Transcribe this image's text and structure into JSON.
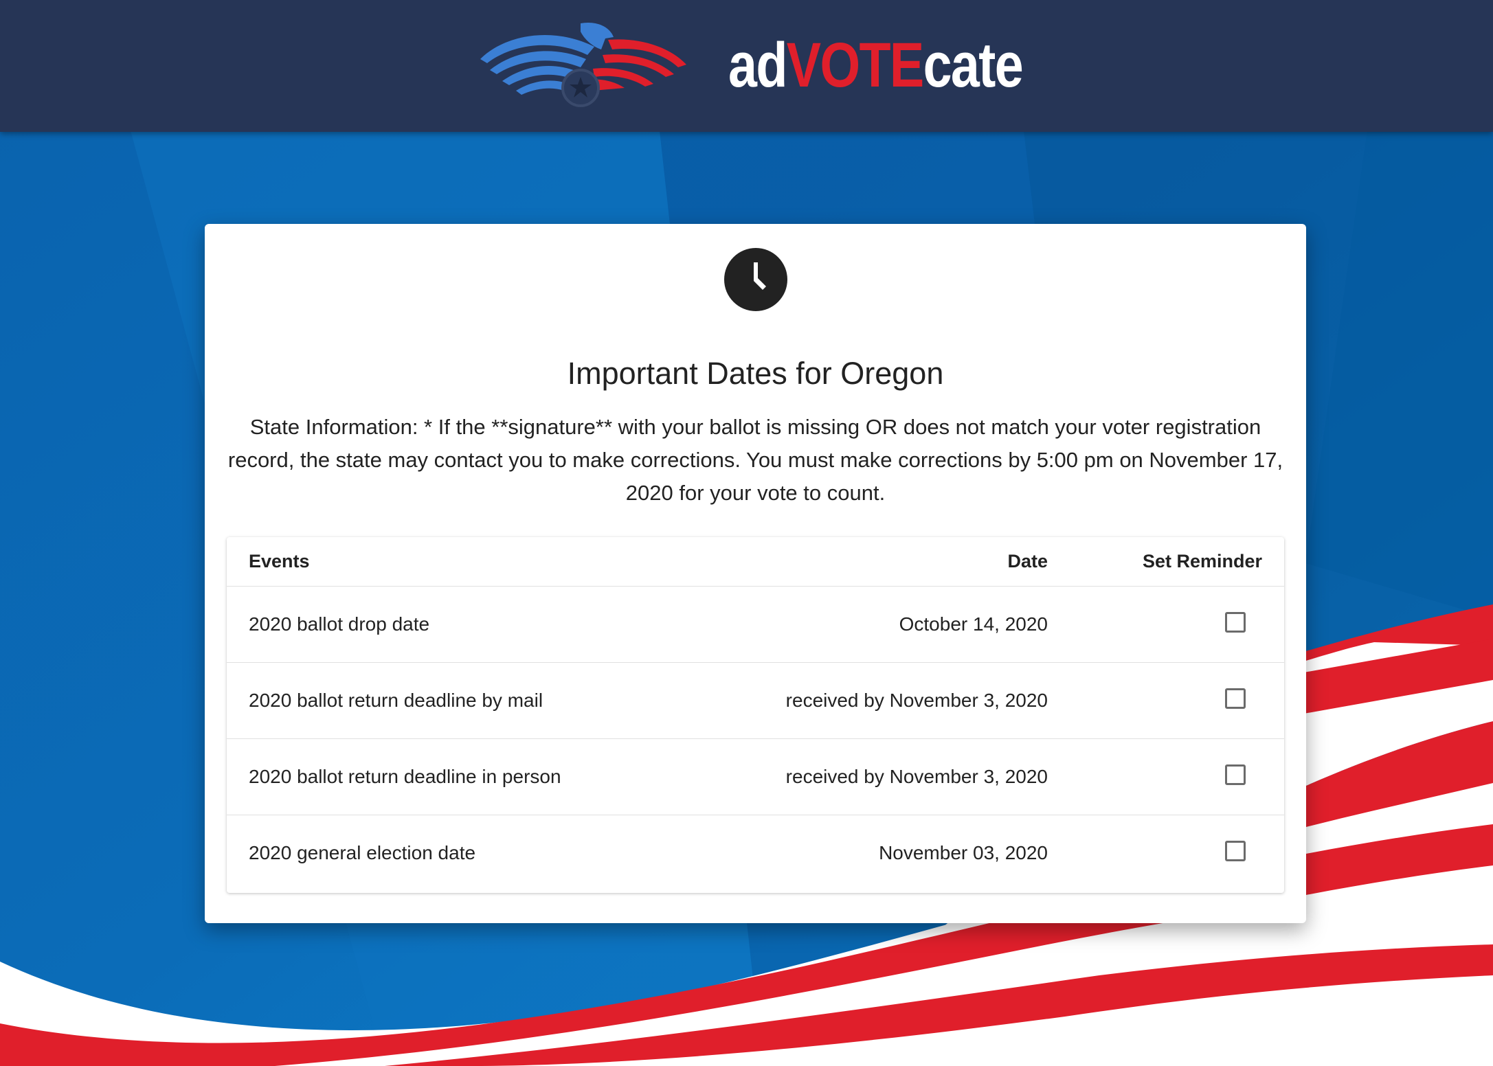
{
  "header": {
    "logo": {
      "part1": "ad",
      "part2": "VOTE",
      "part3": "cate"
    }
  },
  "card": {
    "icon": "clock-icon",
    "title": "Important Dates for Oregon",
    "info": "State Information: * If the **signature** with your ballot is missing OR does not match your voter registration record, the state may contact you to make corrections. You must make corrections by 5:00 pm on November 17, 2020 for your vote to count."
  },
  "table": {
    "headers": {
      "events": "Events",
      "date": "Date",
      "reminder": "Set Reminder"
    },
    "rows": [
      {
        "event": "2020 ballot drop date",
        "date": "October 14, 2020",
        "reminder": false
      },
      {
        "event": "2020 ballot return deadline by mail",
        "date": "received by November 3, 2020",
        "reminder": false
      },
      {
        "event": "2020 ballot return deadline in person",
        "date": "received by November 3, 2020",
        "reminder": false
      },
      {
        "event": "2020 general election date",
        "date": "November 03, 2020",
        "reminder": false
      }
    ]
  },
  "colors": {
    "header_bg": "#263556",
    "brand_red": "#e01f2b",
    "brand_blue": "#3b7fd4",
    "background_blue": "#0a5fa8"
  }
}
